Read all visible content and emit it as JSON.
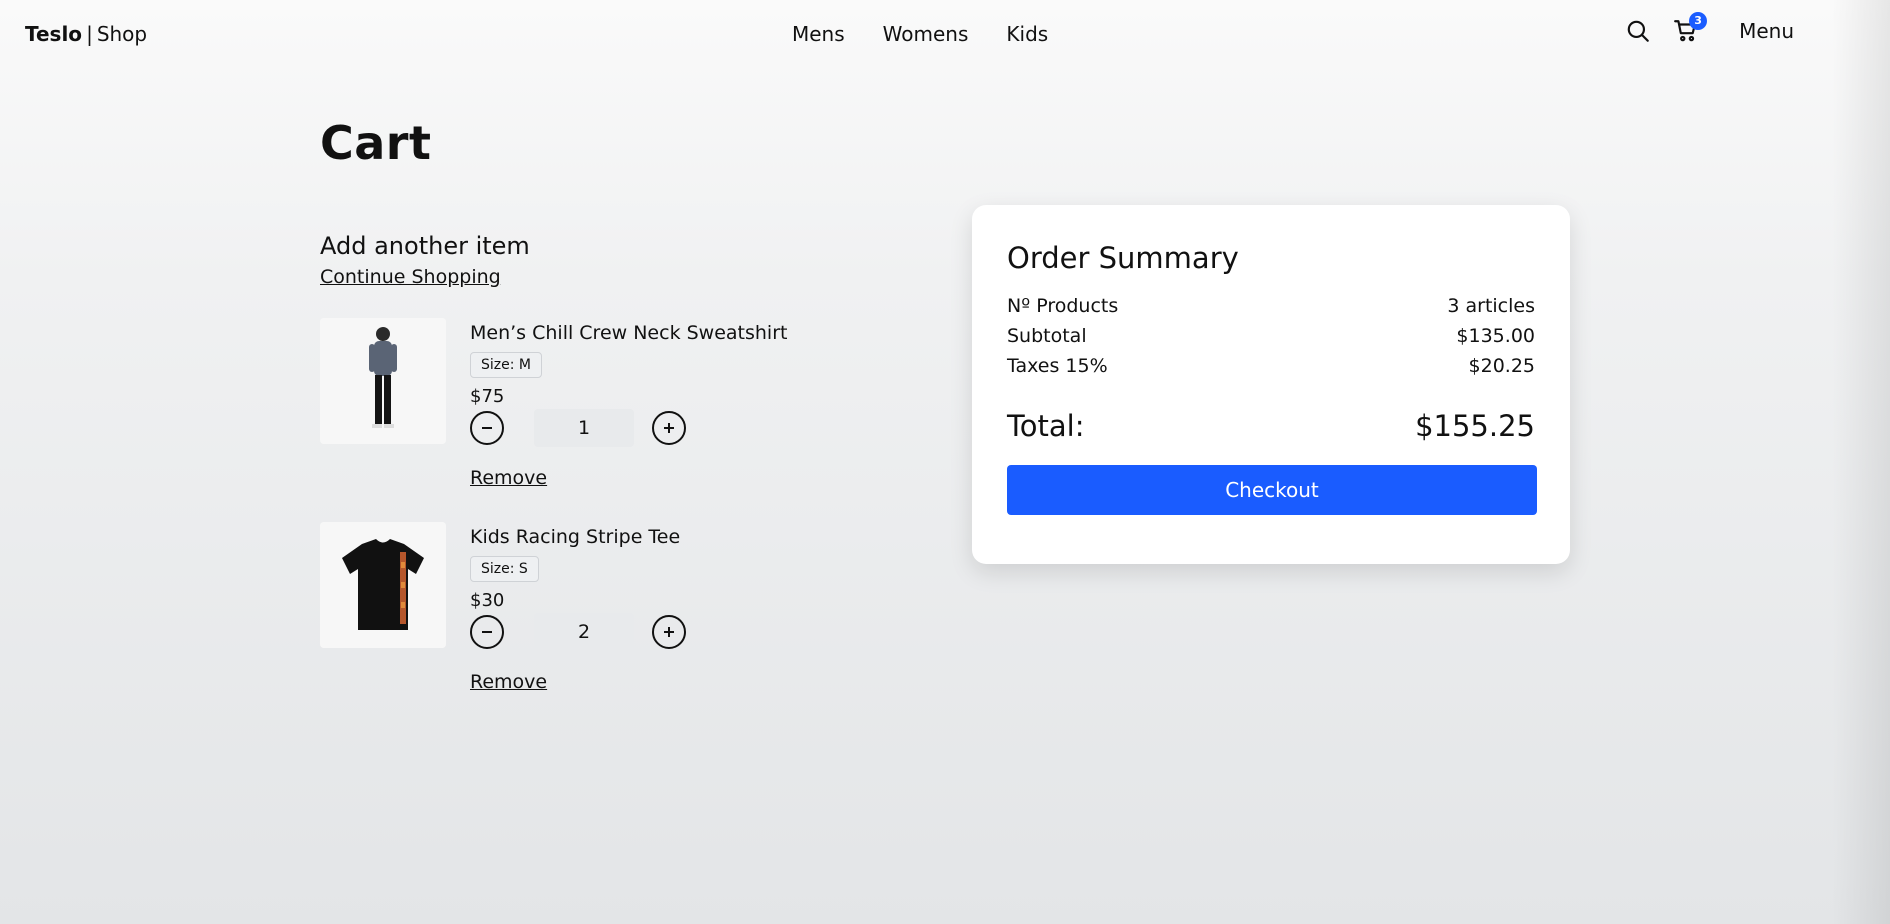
{
  "header": {
    "brand_primary": "Teslo",
    "brand_sep": "|",
    "brand_secondary": "Shop",
    "nav": [
      "Mens",
      "Womens",
      "Kids"
    ],
    "cart_count": "3",
    "menu_label": "Menu",
    "icons": [
      "search-icon",
      "cart-icon"
    ]
  },
  "page": {
    "title": "Cart"
  },
  "cart": {
    "add_title": "Add another item",
    "continue_label": "Continue Shopping",
    "items": [
      {
        "name": "Men’s Chill Crew Neck Sweatshirt",
        "size": "Size: M",
        "price": "$75",
        "qty": "1",
        "remove_label": "Remove"
      },
      {
        "name": "Kids Racing Stripe Tee",
        "size": "Size: S",
        "price": "$30",
        "qty": "2",
        "remove_label": "Remove"
      }
    ]
  },
  "summary": {
    "title": "Order Summary",
    "rows": [
      {
        "label": "Nº Products",
        "value": "3 articles"
      },
      {
        "label": "Subtotal",
        "value": "$135.00"
      },
      {
        "label": "Taxes 15%",
        "value": "$20.25"
      }
    ],
    "total_label": "Total:",
    "total_value": "$155.25",
    "checkout_label": "Checkout"
  },
  "colors": {
    "accent": "#1a5cff"
  }
}
